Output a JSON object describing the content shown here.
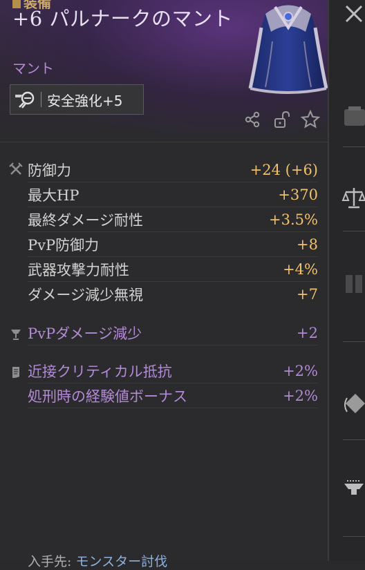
{
  "header": {
    "top_label": "装備",
    "title": "+6 パルナークのマント",
    "category": "マント",
    "enhance_label": "安全強化+5"
  },
  "stats_main": [
    {
      "label": "防御力",
      "value": "+24 (+6)"
    },
    {
      "label": "最大HP",
      "value": "+370"
    },
    {
      "label": "最終ダメージ耐性",
      "value": "+3.5%"
    },
    {
      "label": "PvP防御力",
      "value": "+8"
    },
    {
      "label": "武器攻撃力耐性",
      "value": "+4%"
    },
    {
      "label": "ダメージ減少無視",
      "value": "+7"
    }
  ],
  "stats_pvp": [
    {
      "label": "PvPダメージ減少",
      "value": "+2"
    }
  ],
  "stats_extra": [
    {
      "label": "近接クリティカル抵抗",
      "value": "+2%"
    },
    {
      "label": "処刑時の経験値ボーナス",
      "value": "+2%"
    }
  ],
  "footer": {
    "prefix": "入手先: ",
    "link": "モンスター討伐"
  },
  "colors": {
    "value_gold": "#f0c26e",
    "purple": "#b38ad8",
    "panel_bg": "#2b2b2d"
  },
  "icons": {
    "main_stats": "crossed-swords-icon",
    "pvp_stats": "chalice-icon",
    "extra_stats": "scroll-icon",
    "enhance": "magnifier-icon",
    "share": "share-icon",
    "lock": "unlock-icon",
    "favorite": "star-icon",
    "close": "close-icon"
  }
}
